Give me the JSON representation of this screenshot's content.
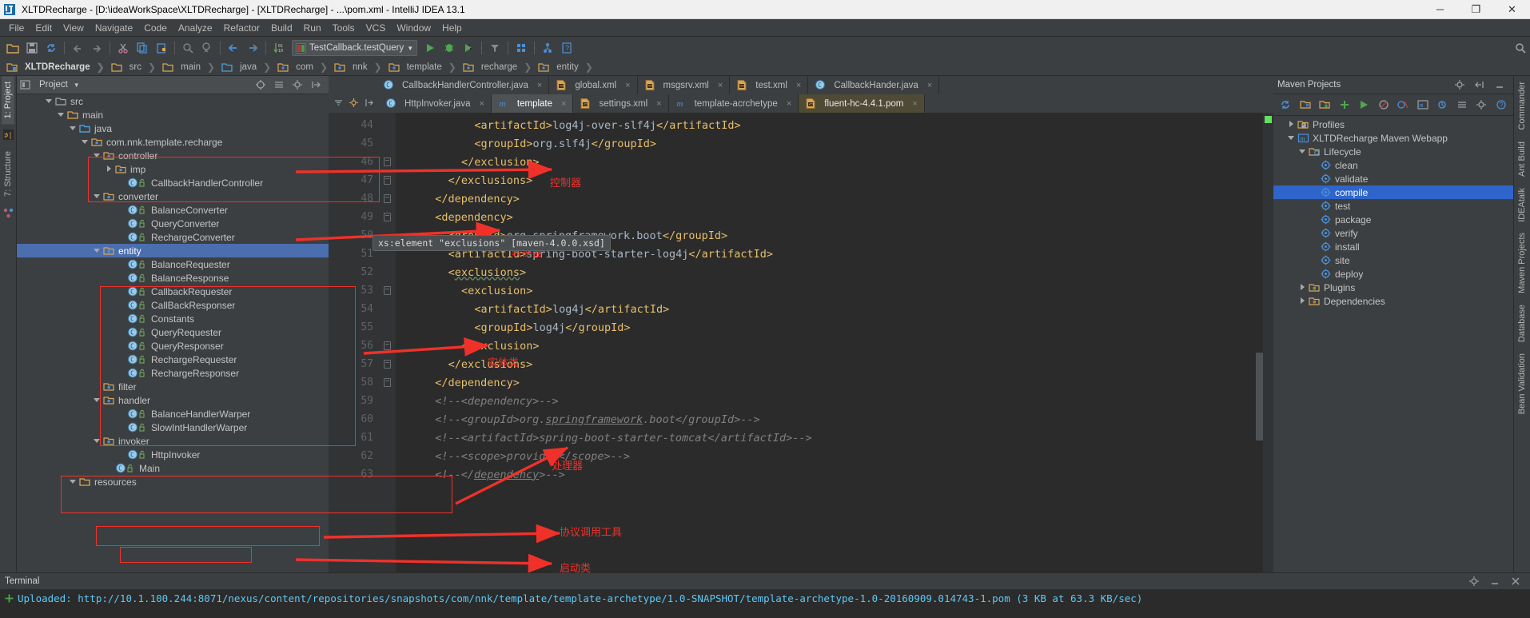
{
  "window": {
    "title": "XLTDRecharge - [D:\\ideaWorkSpace\\XLTDRecharge] - [XLTDRecharge] - ...\\pom.xml - IntelliJ IDEA 13.1",
    "minimize": "─",
    "maximize": "❐",
    "close": "✕"
  },
  "menu": [
    "File",
    "Edit",
    "View",
    "Navigate",
    "Code",
    "Analyze",
    "Refactor",
    "Build",
    "Run",
    "Tools",
    "VCS",
    "Window",
    "Help"
  ],
  "toolbar": {
    "run_config": "TestCallback.testQuery",
    "icons": [
      "open-folder-icon",
      "save-all-icon",
      "sync-icon",
      "undo-icon",
      "redo-icon",
      "cut-icon",
      "copy-icon",
      "paste-icon",
      "find-icon",
      "find-usages-icon",
      "back-icon",
      "forward-icon",
      "toggle-numbers-icon"
    ],
    "right_icons": [
      "run-icon",
      "debug-icon",
      "run-coverage-icon",
      "build-icon",
      "settings-icon",
      "project-structure-icon",
      "help-icon"
    ]
  },
  "breadcrumbs": [
    {
      "label": "XLTDRecharge",
      "icon": "module-icon"
    },
    {
      "label": "src",
      "icon": "folder-icon"
    },
    {
      "label": "main",
      "icon": "folder-icon"
    },
    {
      "label": "java",
      "icon": "source-root-icon"
    },
    {
      "label": "com",
      "icon": "package-icon"
    },
    {
      "label": "nnk",
      "icon": "package-icon"
    },
    {
      "label": "template",
      "icon": "package-icon"
    },
    {
      "label": "recharge",
      "icon": "package-icon"
    },
    {
      "label": "entity",
      "icon": "package-icon"
    }
  ],
  "left_strip": {
    "project_tab": "1: Project",
    "structure_tab": "7: Structure"
  },
  "right_strip": {
    "tabs": [
      "Commander",
      "Ant Build",
      "IDEAtalk",
      "Maven Projects",
      "Database",
      "Bean Validation"
    ]
  },
  "project_panel": {
    "title": "Project",
    "header_icons": [
      "locate-icon",
      "collapse-all-icon",
      "settings-icon",
      "hide-icon"
    ],
    "tree": [
      {
        "label": "src",
        "indent": 2,
        "twisty": "down",
        "icon": "folder-plain-icon",
        "selected": false
      },
      {
        "label": "main",
        "indent": 3,
        "twisty": "down",
        "icon": "folder-icon",
        "selected": false
      },
      {
        "label": "java",
        "indent": 4,
        "twisty": "down",
        "icon": "source-root-icon",
        "selected": false
      },
      {
        "label": "com.nnk.template.recharge",
        "indent": 5,
        "twisty": "down",
        "icon": "package-icon",
        "selected": false
      },
      {
        "label": "controller",
        "indent": 6,
        "twisty": "down",
        "icon": "package-icon",
        "selected": false
      },
      {
        "label": "imp",
        "indent": 7,
        "twisty": "right",
        "icon": "package-icon",
        "selected": false
      },
      {
        "label": "CallbackHandlerController",
        "indent": 8,
        "twisty": "none",
        "icon": "class-icon",
        "selected": false
      },
      {
        "label": "converter",
        "indent": 6,
        "twisty": "down",
        "icon": "package-icon",
        "selected": false
      },
      {
        "label": "BalanceConverter",
        "indent": 8,
        "twisty": "none",
        "icon": "class-icon",
        "selected": false
      },
      {
        "label": "QueryConverter",
        "indent": 8,
        "twisty": "none",
        "icon": "class-icon",
        "selected": false
      },
      {
        "label": "RechargeConverter",
        "indent": 8,
        "twisty": "none",
        "icon": "class-icon",
        "selected": false
      },
      {
        "label": "entity",
        "indent": 6,
        "twisty": "down",
        "icon": "package-icon",
        "selected": true
      },
      {
        "label": "BalanceRequester",
        "indent": 8,
        "twisty": "none",
        "icon": "class-icon",
        "selected": false
      },
      {
        "label": "BalanceResponse",
        "indent": 8,
        "twisty": "none",
        "icon": "class-icon",
        "selected": false
      },
      {
        "label": "CallbackRequester",
        "indent": 8,
        "twisty": "none",
        "icon": "class-icon",
        "selected": false
      },
      {
        "label": "CallBackResponser",
        "indent": 8,
        "twisty": "none",
        "icon": "class-icon",
        "selected": false
      },
      {
        "label": "Constants",
        "indent": 8,
        "twisty": "none",
        "icon": "class-icon",
        "selected": false
      },
      {
        "label": "QueryRequester",
        "indent": 8,
        "twisty": "none",
        "icon": "class-icon",
        "selected": false
      },
      {
        "label": "QueryResponser",
        "indent": 8,
        "twisty": "none",
        "icon": "class-icon",
        "selected": false
      },
      {
        "label": "RechargeRequester",
        "indent": 8,
        "twisty": "none",
        "icon": "class-icon",
        "selected": false
      },
      {
        "label": "RechargeResponser",
        "indent": 8,
        "twisty": "none",
        "icon": "class-icon",
        "selected": false
      },
      {
        "label": "filter",
        "indent": 6,
        "twisty": "none",
        "icon": "package-icon",
        "selected": false
      },
      {
        "label": "handler",
        "indent": 6,
        "twisty": "down",
        "icon": "package-icon",
        "selected": false
      },
      {
        "label": "BalanceHandlerWarper",
        "indent": 8,
        "twisty": "none",
        "icon": "class-icon",
        "selected": false
      },
      {
        "label": "SlowIntHandlerWarper",
        "indent": 8,
        "twisty": "none",
        "icon": "class-icon",
        "selected": false
      },
      {
        "label": "invoker",
        "indent": 6,
        "twisty": "down",
        "icon": "package-icon",
        "selected": false
      },
      {
        "label": "HttpInvoker",
        "indent": 8,
        "twisty": "none",
        "icon": "class-icon",
        "selected": false
      },
      {
        "label": "Main",
        "indent": 7,
        "twisty": "none",
        "icon": "class-icon",
        "selected": false
      },
      {
        "label": "resources",
        "indent": 4,
        "twisty": "down",
        "icon": "folder-icon",
        "selected": false
      }
    ]
  },
  "editor": {
    "tabs_row1": [
      {
        "label": "CallbackHandlerController.java",
        "icon": "java-class-icon",
        "state": "normal"
      },
      {
        "label": "global.xml",
        "icon": "xml-file-icon",
        "state": "normal"
      },
      {
        "label": "msgsrv.xml",
        "icon": "xml-file-icon",
        "state": "normal"
      },
      {
        "label": "test.xml",
        "icon": "xml-file-icon",
        "state": "normal"
      },
      {
        "label": "CallbackHander.java",
        "icon": "java-class-icon",
        "state": "normal"
      }
    ],
    "tabs_row2": [
      {
        "label": "HttpInvoker.java",
        "icon": "java-class-icon",
        "state": "normal"
      },
      {
        "label": "template",
        "icon": "maven-icon",
        "state": "active"
      },
      {
        "label": "settings.xml",
        "icon": "xml-file-icon",
        "state": "normal"
      },
      {
        "label": "template-acrchetype",
        "icon": "maven-icon",
        "state": "normal"
      },
      {
        "label": "fluent-hc-4.4.1.pom",
        "icon": "xml-file-icon",
        "state": "yellow"
      }
    ],
    "close_glyph": "×",
    "tooltip": "xs:element \"exclusions\" [maven-4.0.0.xsd]",
    "lines": [
      {
        "num": 44,
        "fold": false,
        "indent": 12,
        "html": "<span class='tag'>&lt;artifactId&gt;</span><span class='txt'>log4j-over-slf4j</span><span class='tag'>&lt;/artifactId&gt;</span>"
      },
      {
        "num": 45,
        "fold": false,
        "indent": 12,
        "html": "<span class='tag'>&lt;groupId&gt;</span><span class='txt'>org.slf4j</span><span class='tag'>&lt;/groupId&gt;</span>"
      },
      {
        "num": 46,
        "fold": true,
        "indent": 10,
        "html": "<span class='tag'>&lt;/exclusion&gt;</span>"
      },
      {
        "num": 47,
        "fold": true,
        "indent": 8,
        "html": "<span class='tag'>&lt;/exclusions&gt;</span>"
      },
      {
        "num": 48,
        "fold": true,
        "indent": 6,
        "html": "<span class='tag'>&lt;/dependency&gt;</span>"
      },
      {
        "num": 49,
        "fold": true,
        "indent": 6,
        "html": "<span class='tag'>&lt;dependency&gt;</span>"
      },
      {
        "num": 50,
        "fold": false,
        "indent": 8,
        "html": "<span class='tag'>&lt;groupId&gt;</span><span class='txt'>org.springframework.boot</span><span class='tag'>&lt;/groupId&gt;</span>"
      },
      {
        "num": 51,
        "fold": false,
        "indent": 8,
        "html": "<span class='tag'>&lt;artifactId&gt;</span><span class='txt'>spring-boot-starter-log4j</span><span class='tag'>&lt;/artifactId&gt;</span>"
      },
      {
        "num": 52,
        "fold": false,
        "indent": 8,
        "html": "<span class='tag'>&lt;<span class='wavy'>exclusions</span>&gt;</span>"
      },
      {
        "num": 53,
        "fold": true,
        "indent": 10,
        "html": "<span class='tag'>&lt;exclusion&gt;</span>"
      },
      {
        "num": 54,
        "fold": false,
        "indent": 12,
        "html": "<span class='tag'>&lt;artifactId&gt;</span><span class='txt'>log4j</span><span class='tag'>&lt;/artifactId&gt;</span>"
      },
      {
        "num": 55,
        "fold": false,
        "indent": 12,
        "html": "<span class='tag'>&lt;groupId&gt;</span><span class='txt'>log4j</span><span class='tag'>&lt;/groupId&gt;</span>"
      },
      {
        "num": 56,
        "fold": true,
        "indent": 10,
        "html": "<span class='tag'>&lt;/exclusion&gt;</span>"
      },
      {
        "num": 57,
        "fold": true,
        "indent": 8,
        "html": "<span class='tag'>&lt;/exclusions&gt;</span>"
      },
      {
        "num": 58,
        "fold": true,
        "indent": 6,
        "html": "<span class='tag'>&lt;/dependency&gt;</span>"
      },
      {
        "num": 59,
        "fold": false,
        "indent": 6,
        "html": "<span class='cmt'>&lt;!--&lt;dependency&gt;--&gt;</span>"
      },
      {
        "num": 60,
        "fold": false,
        "indent": 6,
        "html": "<span class='cmt'>&lt;!--&lt;groupId&gt;org.<u>springframework</u>.boot&lt;/groupId&gt;--&gt;</span>"
      },
      {
        "num": 61,
        "fold": false,
        "indent": 6,
        "html": "<span class='cmt'>&lt;!--&lt;artifactId&gt;spring-boot-starter-tomcat&lt;/artifactId&gt;--&gt;</span>"
      },
      {
        "num": 62,
        "fold": false,
        "indent": 6,
        "html": "<span class='cmt'>&lt;!--&lt;scope&gt;provided&lt;/scope&gt;--&gt;</span>"
      },
      {
        "num": 63,
        "fold": false,
        "indent": 6,
        "html": "<span class='cmt'>&lt;!--&lt;/<u>dependency</u>&gt;--&gt;</span>"
      }
    ]
  },
  "maven_panel": {
    "title": "Maven Projects",
    "toolbar_icons": [
      "refresh-icon",
      "add-maven-project-icon",
      "download-sources-icon",
      "add-icon",
      "run-icon",
      "offline-icon",
      "skip-tests-icon",
      "execute-goal-icon",
      "toggle-icon",
      "collapse-icon",
      "settings-icon",
      "help-icon"
    ],
    "tree": [
      {
        "label": "Profiles",
        "indent": 1,
        "twisty": "right",
        "icon": "profiles-icon",
        "selected": false
      },
      {
        "label": "XLTDRecharge Maven Webapp",
        "indent": 1,
        "twisty": "down",
        "icon": "maven-module-icon",
        "selected": false
      },
      {
        "label": "Lifecycle",
        "indent": 2,
        "twisty": "down",
        "icon": "lifecycle-icon",
        "selected": false
      },
      {
        "label": "clean",
        "indent": 3,
        "twisty": "none",
        "icon": "goal-icon",
        "selected": false
      },
      {
        "label": "validate",
        "indent": 3,
        "twisty": "none",
        "icon": "goal-icon",
        "selected": false
      },
      {
        "label": "compile",
        "indent": 3,
        "twisty": "none",
        "icon": "goal-icon",
        "selected": true
      },
      {
        "label": "test",
        "indent": 3,
        "twisty": "none",
        "icon": "goal-icon",
        "selected": false
      },
      {
        "label": "package",
        "indent": 3,
        "twisty": "none",
        "icon": "goal-icon",
        "selected": false
      },
      {
        "label": "verify",
        "indent": 3,
        "twisty": "none",
        "icon": "goal-icon",
        "selected": false
      },
      {
        "label": "install",
        "indent": 3,
        "twisty": "none",
        "icon": "goal-icon",
        "selected": false
      },
      {
        "label": "site",
        "indent": 3,
        "twisty": "none",
        "icon": "goal-icon",
        "selected": false
      },
      {
        "label": "deploy",
        "indent": 3,
        "twisty": "none",
        "icon": "goal-icon",
        "selected": false
      },
      {
        "label": "Plugins",
        "indent": 2,
        "twisty": "right",
        "icon": "plugins-icon",
        "selected": false
      },
      {
        "label": "Dependencies",
        "indent": 2,
        "twisty": "right",
        "icon": "dependencies-icon",
        "selected": false
      }
    ]
  },
  "terminal": {
    "title": "Terminal",
    "line": "Uploaded: http://10.1.100.244:8071/nexus/content/repositories/snapshots/com/nnk/template/template-archetype/1.0-SNAPSHOT/template-archetype-1.0-20160909.014743-1.pom (3 KB at 63.3 KB/sec)"
  },
  "annotations": {
    "controller": "控制器",
    "converter": "转换器",
    "entity": "实体类",
    "handler": "处理器",
    "invoker": "协议调用工具",
    "main": "启动类"
  },
  "colors": {
    "accent_red": "#f0312a",
    "selection_blue": "#4b6eaf",
    "maven_selection": "#2f65ca",
    "editor_bg": "#2b2b2b",
    "panel_bg": "#3c3f41",
    "tag_color": "#e8bf6a",
    "comment_color": "#808080"
  }
}
